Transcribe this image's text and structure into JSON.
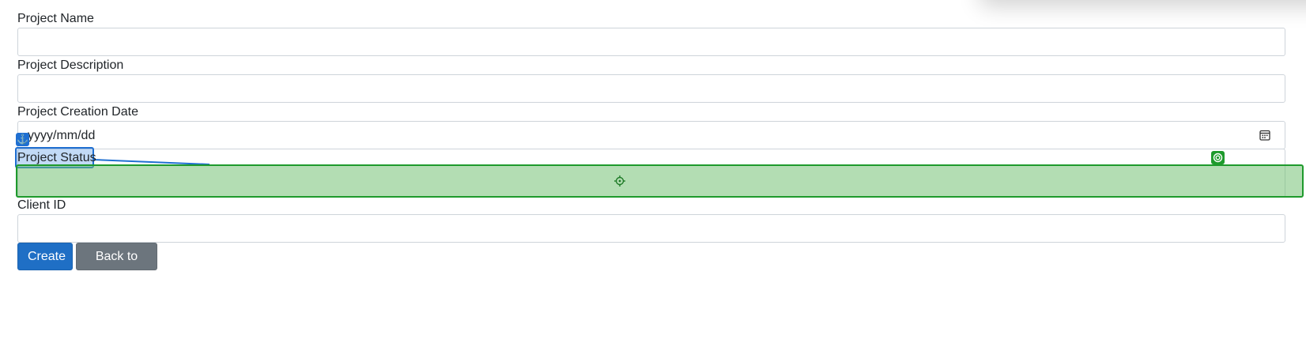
{
  "form": {
    "fields": [
      {
        "label": "Project Name",
        "value": "",
        "placeholder": ""
      },
      {
        "label": "Project Description",
        "value": "",
        "placeholder": ""
      },
      {
        "label": "Project Creation Date",
        "value": "",
        "placeholder": "yyyy/mm/dd"
      },
      {
        "label": "Project Status",
        "value": ""
      },
      {
        "label": "Client ID",
        "value": "",
        "placeholder": ""
      }
    ]
  },
  "actions": {
    "create_label": "Create",
    "back_label": "Back to List"
  },
  "icons": {
    "calendar": "calendar-icon",
    "anchor": "anchor-icon",
    "crosshair": "crosshair-icon",
    "target": "target-icon"
  },
  "colors": {
    "primary": "#1f6fc5",
    "secondary": "#6c757d",
    "annotation_source": "#1f6fd1",
    "annotation_target": "#1e9a2c"
  }
}
